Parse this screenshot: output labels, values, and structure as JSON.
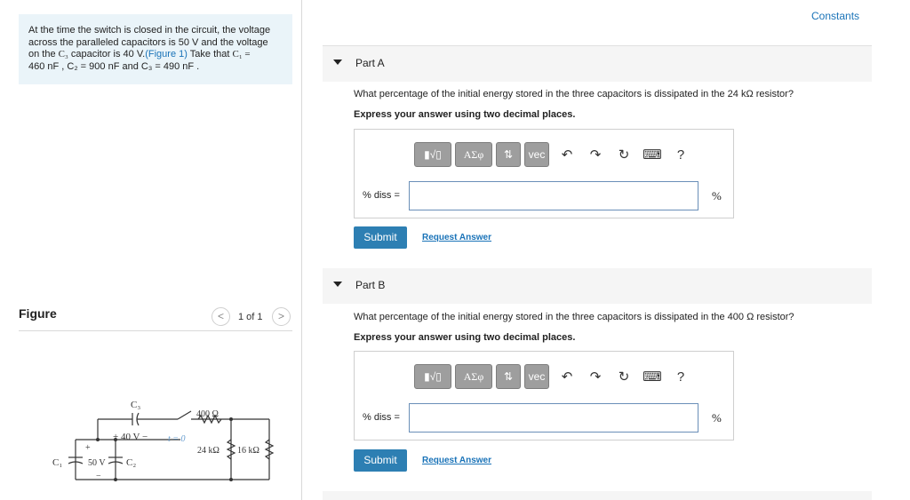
{
  "problem": {
    "line1": "At the time the switch is closed in the circuit, the voltage",
    "line2": "across the paralleled capacitors is 50 V and the voltage",
    "line3a": "on the ",
    "c3": "C₃",
    "line3b": " capacitor is 40 V.",
    "figure_link": "(Figure 1)",
    "line3c": " Take that ",
    "c1_eq": "C₁ =",
    "line4": "460 nF , C₂ = 900 nF and C₃ = 490 nF ."
  },
  "figure": {
    "title": "Figure",
    "pager": "1 of 1",
    "prev": "<",
    "next": ">"
  },
  "circuit": {
    "c3": "C₃",
    "c1": "C₁",
    "c2": "C₂",
    "v40": "+ 40 V −",
    "v50": "50 V",
    "plus": "+",
    "minus": "−",
    "t0": "t = 0",
    "r400": "400 Ω",
    "r24": "24 kΩ",
    "r16": "16 kΩ"
  },
  "header": {
    "constants": "Constants"
  },
  "parts": [
    {
      "label": "Part A",
      "question": "What percentage of the initial energy stored in the three capacitors is dissipated in the 24 kΩ resistor?",
      "instruction": "Express your answer using two decimal places.",
      "answer_label": "% diss =",
      "answer_value": "",
      "unit": "%",
      "submit": "Submit",
      "request": "Request Answer"
    },
    {
      "label": "Part B",
      "question": "What percentage of the initial energy stored in the three capacitors is dissipated in the 400 Ω resistor?",
      "instruction": "Express your answer using two decimal places.",
      "answer_label": "% diss =",
      "answer_value": "",
      "unit": "%",
      "submit": "Submit",
      "request": "Request Answer"
    }
  ],
  "toolbar": {
    "templates": "▮√▯",
    "greek": "ΑΣφ",
    "arrows": "⇅",
    "vec": "vec",
    "undo": "↶",
    "redo": "↷",
    "reset": "↻",
    "keyboard": "⌨",
    "help": "?"
  },
  "colors": {
    "accent": "#1a73b8",
    "submit": "#2d7fb3",
    "problem_bg": "#eaf4f9"
  }
}
